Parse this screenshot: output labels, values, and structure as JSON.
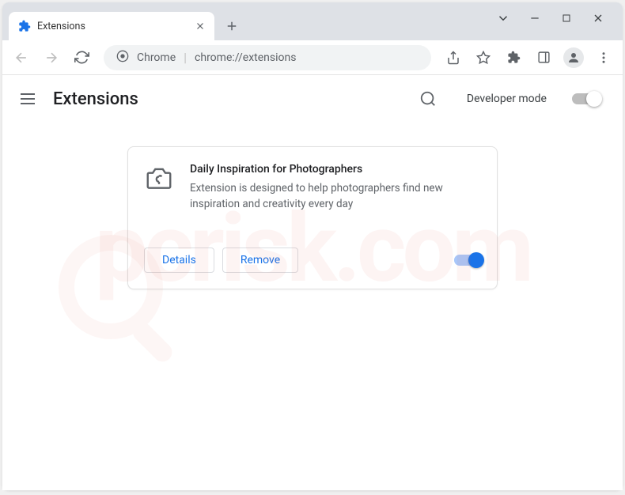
{
  "tab": {
    "title": "Extensions"
  },
  "omnibox": {
    "label": "Chrome",
    "url": "chrome://extensions"
  },
  "page": {
    "title": "Extensions",
    "devmode_label": "Developer mode"
  },
  "extension": {
    "name": "Daily Inspiration for Photographers",
    "description": "Extension is designed to help photographers find new inspiration and creativity every day",
    "details_label": "Details",
    "remove_label": "Remove"
  },
  "watermark": "pcrisk.com"
}
